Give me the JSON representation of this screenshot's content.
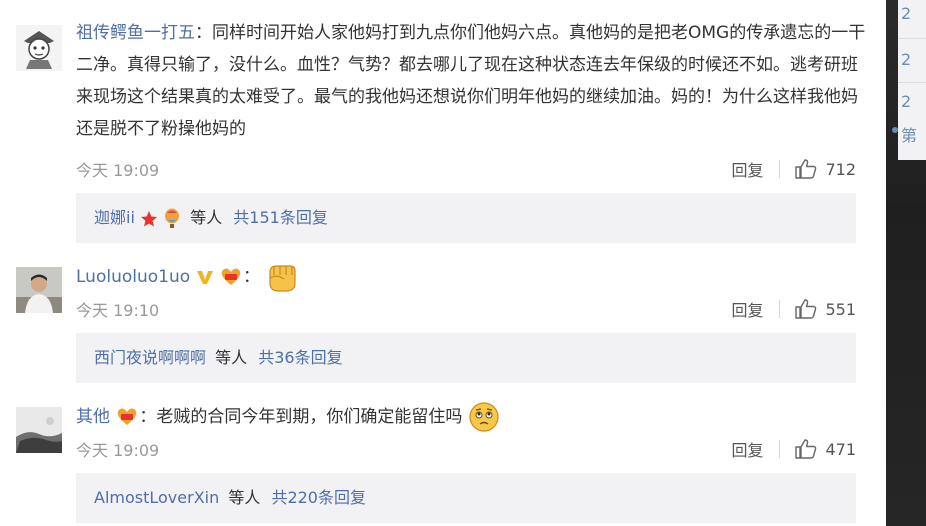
{
  "comments": [
    {
      "username": "祖传鳄鱼一打五",
      "separator": "：",
      "text": "同样时间开始人家他妈打到九点你们他妈六点。真他妈的是把老OMG的传承遗忘的一干二净。真得只输了，没什么。血性？气势？都去哪儿了现在这种状态连去年保级的时候还不如。逃考研班来现场这个结果真的太难受了。最气的我他妈还想说你们明年他妈的继续加油。妈的！为什么这样我他妈还是脱不了粉操他妈的",
      "time": "今天 19:09",
      "reply_label": "回复",
      "likes": "712",
      "reply_preview": {
        "names": "迦娜ii",
        "etc": "等人",
        "total": "共151条回复"
      }
    },
    {
      "username": "Luoluoluo1uo",
      "separator": "：",
      "text": "",
      "time": "今天 19:10",
      "reply_label": "回复",
      "likes": "551",
      "reply_preview": {
        "names": "西门夜说啊啊啊",
        "etc": "等人",
        "total": "共36条回复"
      }
    },
    {
      "username": "其他",
      "separator": "：",
      "text": "老贼的合同今年到期，你们确定能留住吗",
      "time": "今天 19:09",
      "reply_label": "回复",
      "likes": "471",
      "reply_preview": {
        "names": "AlmostLoverXin",
        "etc": "等人",
        "total": "共220条回复"
      }
    }
  ],
  "sidebar": {
    "items": [
      "2",
      "2",
      "2",
      "第"
    ]
  },
  "colors": {
    "link": "#4e6fa7",
    "reply_box": "#f2f2f5",
    "muted": "#999999"
  }
}
